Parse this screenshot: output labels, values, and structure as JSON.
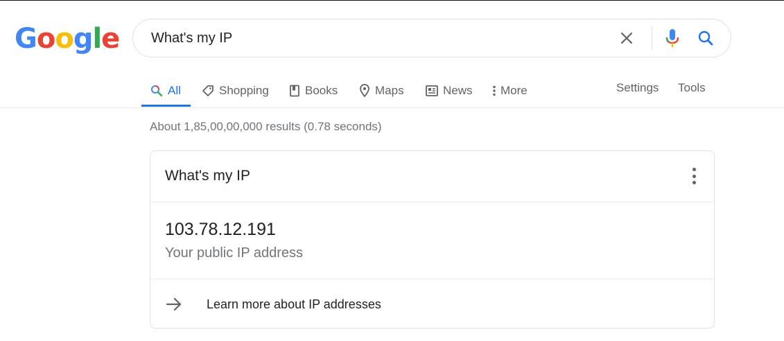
{
  "logo": {
    "letters": [
      {
        "ch": "G",
        "color": "#4285F4"
      },
      {
        "ch": "o",
        "color": "#EA4335"
      },
      {
        "ch": "o",
        "color": "#FBBC05"
      },
      {
        "ch": "g",
        "color": "#4285F4"
      },
      {
        "ch": "l",
        "color": "#34A853"
      },
      {
        "ch": "e",
        "color": "#EA4335"
      }
    ]
  },
  "search": {
    "query": "What's my IP",
    "clear_icon": "close-icon",
    "mic_icon": "microphone-icon",
    "search_icon": "search-icon"
  },
  "tabs": [
    {
      "label": "All",
      "icon": "search-icon",
      "active": true
    },
    {
      "label": "Shopping",
      "icon": "tag-icon"
    },
    {
      "label": "Books",
      "icon": "book-icon"
    },
    {
      "label": "Maps",
      "icon": "map-pin-icon"
    },
    {
      "label": "News",
      "icon": "newspaper-icon"
    },
    {
      "label": "More",
      "icon": "more-vert-icon"
    }
  ],
  "tools": {
    "settings": "Settings",
    "tools": "Tools"
  },
  "result_stats": "About 1,85,00,00,000 results (0.78 seconds)",
  "card": {
    "title": "What's my IP",
    "ip": "103.78.12.191",
    "ip_label": "Your public IP address",
    "learn_more": "Learn more about IP addresses"
  },
  "colors": {
    "accent": "#1a73e8",
    "muted": "#5f6368",
    "border": "#dfe1e5"
  }
}
